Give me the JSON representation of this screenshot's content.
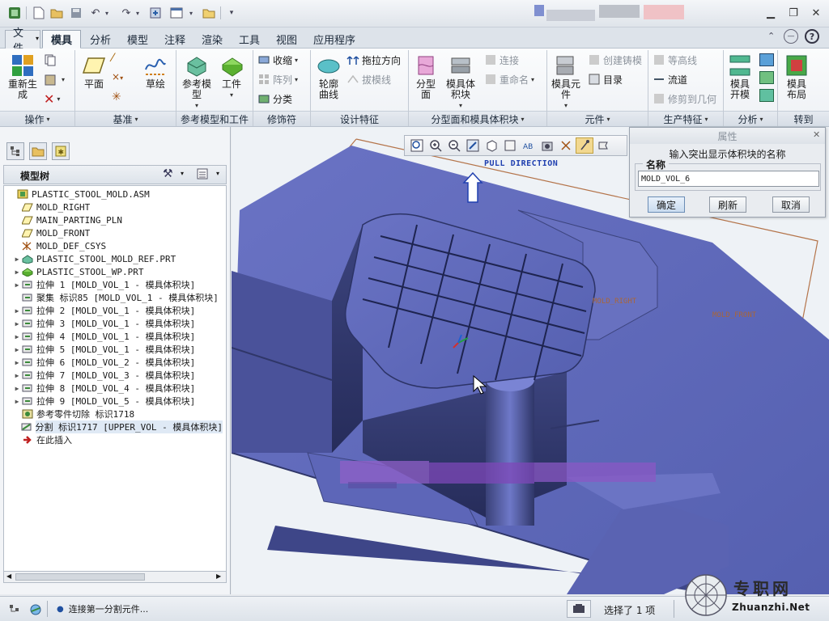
{
  "quick_access": {
    "icons": [
      "app-icon",
      "new-icon",
      "open-icon",
      "save-icon",
      "undo-icon",
      "redo-icon",
      "regenerate-icon",
      "window-icon",
      "close-window-icon",
      "customize-icon"
    ]
  },
  "ribbon_tabs": [
    {
      "label": "文件",
      "active": false,
      "file": true
    },
    {
      "label": "模具",
      "active": true
    },
    {
      "label": "分析",
      "active": false
    },
    {
      "label": "模型",
      "active": false
    },
    {
      "label": "注释",
      "active": false
    },
    {
      "label": "渲染",
      "active": false
    },
    {
      "label": "工具",
      "active": false
    },
    {
      "label": "视图",
      "active": false
    },
    {
      "label": "应用程序",
      "active": false
    }
  ],
  "ribbon": {
    "groups": {
      "operations": "操作",
      "datum": "基准",
      "ref_model": "参考模型和工件",
      "modifiers": "修饰符",
      "design_features": "设计特征",
      "parting": "分型面和模具体积块",
      "components": "元件",
      "production": "生产特征",
      "analysis": "分析",
      "goto": "转到"
    },
    "regenerate": "重新生成",
    "plane": "平面",
    "sketch": "草绘",
    "ref_model_btn": "参考模型",
    "workpiece": "工件",
    "shrink": "收缩",
    "pattern": "阵列",
    "classify": "分类",
    "silhouette": "轮廓曲线",
    "pull_direction": "拖拉方向",
    "draft_line": "拔模线",
    "parting_surface": "分型面",
    "mold_volume": "模具体积块",
    "connect": "连接",
    "rename": "重命名",
    "mold_component": "模具元件",
    "create_casting": "创建铸模",
    "catalog": "目录",
    "contour": "等高线",
    "flow": "流道",
    "trim_to_geometry": "修剪到几何",
    "mold_open": "模具开模",
    "mold_layout": "模具布局"
  },
  "left_panel": {
    "header_title": "模型树",
    "tree": [
      {
        "exp": "",
        "icon": "assembly-icon",
        "text": "PLASTIC_STOOL_MOLD.ASM",
        "indent": 0
      },
      {
        "exp": "",
        "icon": "datum-plane-icon",
        "text": "MOLD_RIGHT",
        "indent": 1
      },
      {
        "exp": "",
        "icon": "datum-plane-icon",
        "text": "MAIN_PARTING_PLN",
        "indent": 1
      },
      {
        "exp": "",
        "icon": "datum-plane-icon",
        "text": "MOLD_FRONT",
        "indent": 1
      },
      {
        "exp": "",
        "icon": "csys-icon",
        "text": "MOLD_DEF_CSYS",
        "indent": 1
      },
      {
        "exp": "▶",
        "icon": "ref-part-icon",
        "text": "PLASTIC_STOOL_MOLD_REF.PRT",
        "indent": 1
      },
      {
        "exp": "▶",
        "icon": "workpiece-icon",
        "text": "PLASTIC_STOOL_WP.PRT",
        "indent": 1
      },
      {
        "exp": "▶",
        "icon": "extrude-icon",
        "text": "拉伸 1 [MOLD_VOL_1 - 模具体积块]",
        "indent": 1
      },
      {
        "exp": "",
        "icon": "extrude-icon",
        "text": "聚集 标识85 [MOLD_VOL_1 - 模具体积块]",
        "indent": 1
      },
      {
        "exp": "▶",
        "icon": "extrude-icon",
        "text": "拉伸 2 [MOLD_VOL_1 - 模具体积块]",
        "indent": 1
      },
      {
        "exp": "▶",
        "icon": "extrude-icon",
        "text": "拉伸 3 [MOLD_VOL_1 - 模具体积块]",
        "indent": 1
      },
      {
        "exp": "▶",
        "icon": "extrude-icon",
        "text": "拉伸 4 [MOLD_VOL_1 - 模具体积块]",
        "indent": 1
      },
      {
        "exp": "▶",
        "icon": "extrude-icon",
        "text": "拉伸 5 [MOLD_VOL_1 - 模具体积块]",
        "indent": 1
      },
      {
        "exp": "▶",
        "icon": "extrude-icon",
        "text": "拉伸 6 [MOLD_VOL_2 - 模具体积块]",
        "indent": 1
      },
      {
        "exp": "▶",
        "icon": "extrude-icon",
        "text": "拉伸 7 [MOLD_VOL_3 - 模具体积块]",
        "indent": 1
      },
      {
        "exp": "▶",
        "icon": "extrude-icon",
        "text": "拉伸 8 [MOLD_VOL_4 - 模具体积块]",
        "indent": 1
      },
      {
        "exp": "▶",
        "icon": "extrude-icon",
        "text": "拉伸 9 [MOLD_VOL_5 - 模具体积块]",
        "indent": 1
      },
      {
        "exp": "",
        "icon": "ref-cut-icon",
        "text": "参考零件切除 标识1718",
        "indent": 1
      },
      {
        "exp": "",
        "icon": "split-icon",
        "text": "分割 标识1717 [UPPER_VOL - 模具体积块]",
        "indent": 1,
        "selected": true
      },
      {
        "exp": "",
        "icon": "insert-here-icon",
        "text": "在此插入",
        "indent": 1
      }
    ]
  },
  "viewport": {
    "pull_direction_label": "PULL DIRECTION",
    "mold_right_label": "MOLD_RIGHT",
    "mold_front_label": "MOLD_FRONT",
    "colors": {
      "model": "#5d66b8",
      "background": "#eef2f6",
      "datum_frame": "#b4744a"
    }
  },
  "dialog": {
    "title": "属性",
    "prompt": "输入突出显示体积块的名称",
    "name_label": "名称",
    "name_value": "MOLD_VOL_6",
    "ok_label": "确定",
    "refresh_label": "刷新",
    "cancel_label": "取消"
  },
  "status": {
    "message": "连接第一分割元件...",
    "selection": "选择了 1 项"
  },
  "watermark": {
    "cn": "专职网",
    "url": "Zhuanzhi.Net"
  }
}
